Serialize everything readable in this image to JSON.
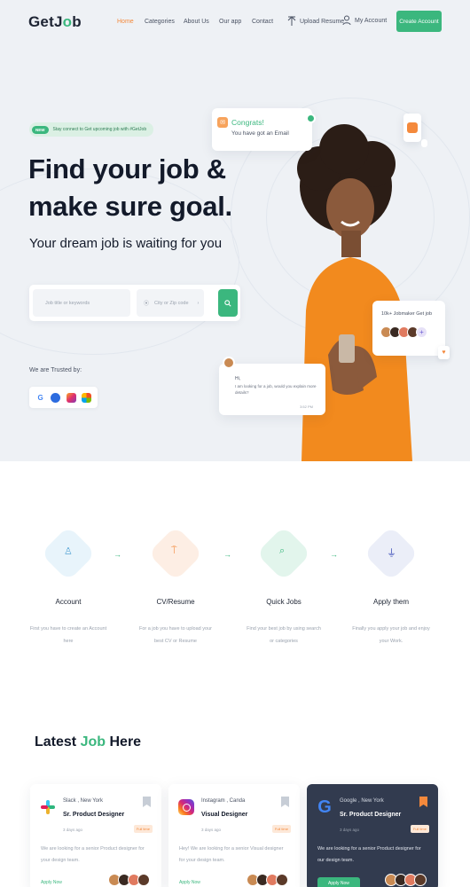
{
  "nav": {
    "logo_prefix": "GetJ",
    "logo_o": "o",
    "logo_suffix": "b",
    "links": [
      "Home",
      "Categories",
      "About Us",
      "Our app",
      "Contact"
    ],
    "upload": "Upload Resume",
    "account": "My Account",
    "create": "Create Account"
  },
  "hero": {
    "tag_new": "NEW",
    "tag_text": "Stay connect to Get upcoming job with #GetJob",
    "headline_line1": "Find your job &",
    "headline_line2": "make sure goal.",
    "subheading": "Your dream job is waiting for you",
    "search_keyword_placeholder": "Job title or keywords",
    "search_location_placeholder": "City or Zip code",
    "trusted": "We are Trusted by:",
    "congrats_title": "Congrats!",
    "congrats_text": "You have got an Email",
    "applicants_text": "10k+ Jobmaker Get job",
    "chat_hi": "Hi,",
    "chat_msg": "I am looking for a job, would you explain more details?",
    "chat_time": "3:52 PM"
  },
  "steps": [
    {
      "title": "Account",
      "desc": "First you have to create an Account here"
    },
    {
      "title": "CV/Resume",
      "desc": "For a job you have to upload your best CV or Resume"
    },
    {
      "title": "Quick Jobs",
      "desc": "Find your best job by using search or categories"
    },
    {
      "title": "Apply them",
      "desc": "Finally you apply your job and enjoy your Work."
    }
  ],
  "latest": {
    "word1": "Latest",
    "word2": "Job",
    "word3": "Here"
  },
  "jobs": [
    {
      "company": "Slack , New York",
      "role": "Sr. Product Designer",
      "ago": "3 days ago",
      "tag": "Full time",
      "desc": "We are looking for a senior Product designer for your design team.",
      "apply": "Apply Now"
    },
    {
      "company": "Instagram , Canda",
      "role": "Visual Designer",
      "ago": "3 days ago",
      "tag": "Full time",
      "desc": "Hey! We are looking for a senior Visual designer for your design team.",
      "apply": "Apply Now"
    },
    {
      "company": "Google , New York",
      "role": "Sr. Product Designer",
      "ago": "3 days ago",
      "tag": "Full time",
      "desc": "We are looking for a senior Product designer for our design team.",
      "apply": "Apply Now"
    }
  ],
  "colors": {
    "accent": "#3bb77e",
    "orange": "#f4893c",
    "dark_card": "#323b4f"
  }
}
